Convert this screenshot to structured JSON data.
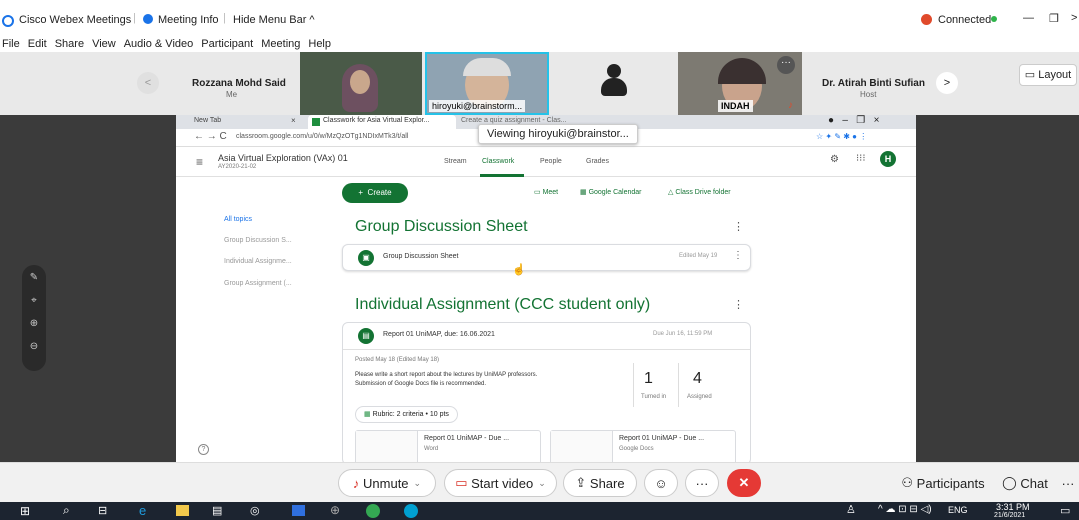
{
  "titlebar": {
    "app": "Cisco Webex Meetings",
    "meeting_info": "Meeting Info",
    "hide_menu": "Hide Menu Bar ^",
    "status": "Connected",
    "min": "—",
    "max": "❐",
    "close": ">"
  },
  "menu": [
    "File",
    "Edit",
    "Share",
    "View",
    "Audio & Video",
    "Participant",
    "Meeting",
    "Help"
  ],
  "participants": {
    "p1_name": "Rozzana Mohd Said",
    "p1_role": "Me",
    "p2_label": "hiroyuki@brainstorm...",
    "p3_label": "INDAH",
    "p4_name": "Dr. Atirah Binti Sufian",
    "p4_role": "Host",
    "layout": "Layout"
  },
  "browser": {
    "tab1": "New Tab",
    "tab2": "Classwork for Asia Virtual Explor...",
    "tab3": "Create a quiz assignment - Clas...",
    "url": "classroom.google.com/u/0/w/MzQzOTg1NDIxMTk3/t/all",
    "viewing": "Viewing hiroyuki@brainstor...",
    "course_name": "Asia Virtual Exploration (VAx) 01",
    "course_sub": "AY2020-21-02",
    "tabs": [
      "Stream",
      "Classwork",
      "People",
      "Grades"
    ],
    "avatar": "H",
    "create": "Create",
    "meet": "Meet",
    "calendar": "Google Calendar",
    "drive": "Class Drive folder",
    "topics": [
      "All topics",
      "Group Discussion S...",
      "Individual Assignme...",
      "Group Assignment (..."
    ],
    "section1": "Group Discussion Sheet",
    "item1": "Group Discussion Sheet",
    "item1_meta": "Edited May 19",
    "section2": "Individual Assignment (CCC student only)",
    "item2": "Report 01 UniMAP, due: 16.06.2021",
    "item2_due": "Due Jun 16, 11:59 PM",
    "posted": "Posted May 18 (Edited May 18)",
    "desc1": "Please write a short report about the lectures by UniMAP professors.",
    "desc2": "Submission of Google Docs file is recommended.",
    "turned_in_n": "1",
    "turned_in": "Turned in",
    "assigned_n": "4",
    "assigned": "Assigned",
    "rubric": "Rubric: 2 criteria • 10 pts",
    "att1": "Report 01 UniMAP - Due ...",
    "att1_type": "Word",
    "att2": "Report 01 UniMAP - Due ...",
    "att2_type": "Google Docs"
  },
  "controls": {
    "unmute": "Unmute",
    "video": "Start video",
    "share": "Share",
    "more": "···",
    "participants": "Participants",
    "chat": "Chat"
  },
  "taskbar": {
    "lang": "ENG",
    "time": "3:31 PM",
    "date": "21/6/2021"
  },
  "colors": {
    "accent": "#137333",
    "end": "#e53935",
    "webex_blue": "#00a0d1"
  }
}
